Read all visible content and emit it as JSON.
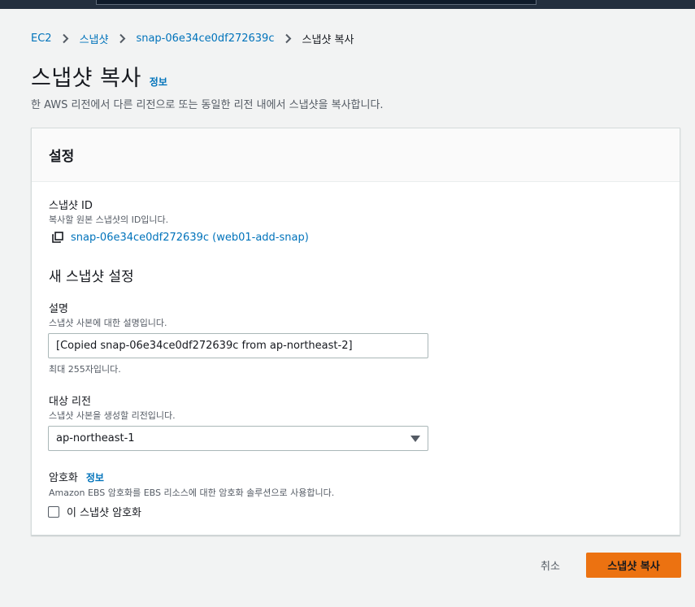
{
  "breadcrumb": {
    "items": [
      "EC2",
      "스냅샷",
      "snap-06e34ce0df272639c"
    ],
    "current": "스냅샷 복사"
  },
  "page": {
    "title": "스냅샷 복사",
    "info_link": "정보",
    "description": "한 AWS 리전에서 다른 리전으로 또는 동일한 리전 내에서 스냅샷을 복사합니다."
  },
  "settings": {
    "header": "설정",
    "snapshot_id": {
      "label": "스냅샷 ID",
      "hint": "복사할 원본 스냅샷의 ID입니다.",
      "value": "snap-06e34ce0df272639c (web01-add-snap)"
    },
    "new_snapshot_title": "새 스냅샷 설정",
    "description_field": {
      "label": "설명",
      "hint": "스냅샷 사본에 대한 설명입니다.",
      "value": "[Copied snap-06e34ce0df272639c from ap-northeast-2]",
      "constraint": "최대 255자입니다."
    },
    "destination_region": {
      "label": "대상 리전",
      "hint": "스냅샷 사본을 생성할 리전입니다.",
      "selected": "ap-northeast-1"
    },
    "encryption": {
      "label": "암호화",
      "info_link": "정보",
      "hint": "Amazon EBS 암호화를 EBS 리소스에 대한 암호화 솔루션으로 사용합니다.",
      "checkbox_label": "이 스냅샷 암호화",
      "checked": false
    }
  },
  "actions": {
    "cancel": "취소",
    "submit": "스냅샷 복사"
  },
  "colors": {
    "link": "#0073bb",
    "primary_button": "#ec7211",
    "topbar": "#232f3e",
    "background": "#f2f3f3"
  },
  "icons": {
    "breadcrumb_separator": "chevron-right-icon",
    "copy": "copy-icon",
    "dropdown": "caret-down-icon"
  }
}
